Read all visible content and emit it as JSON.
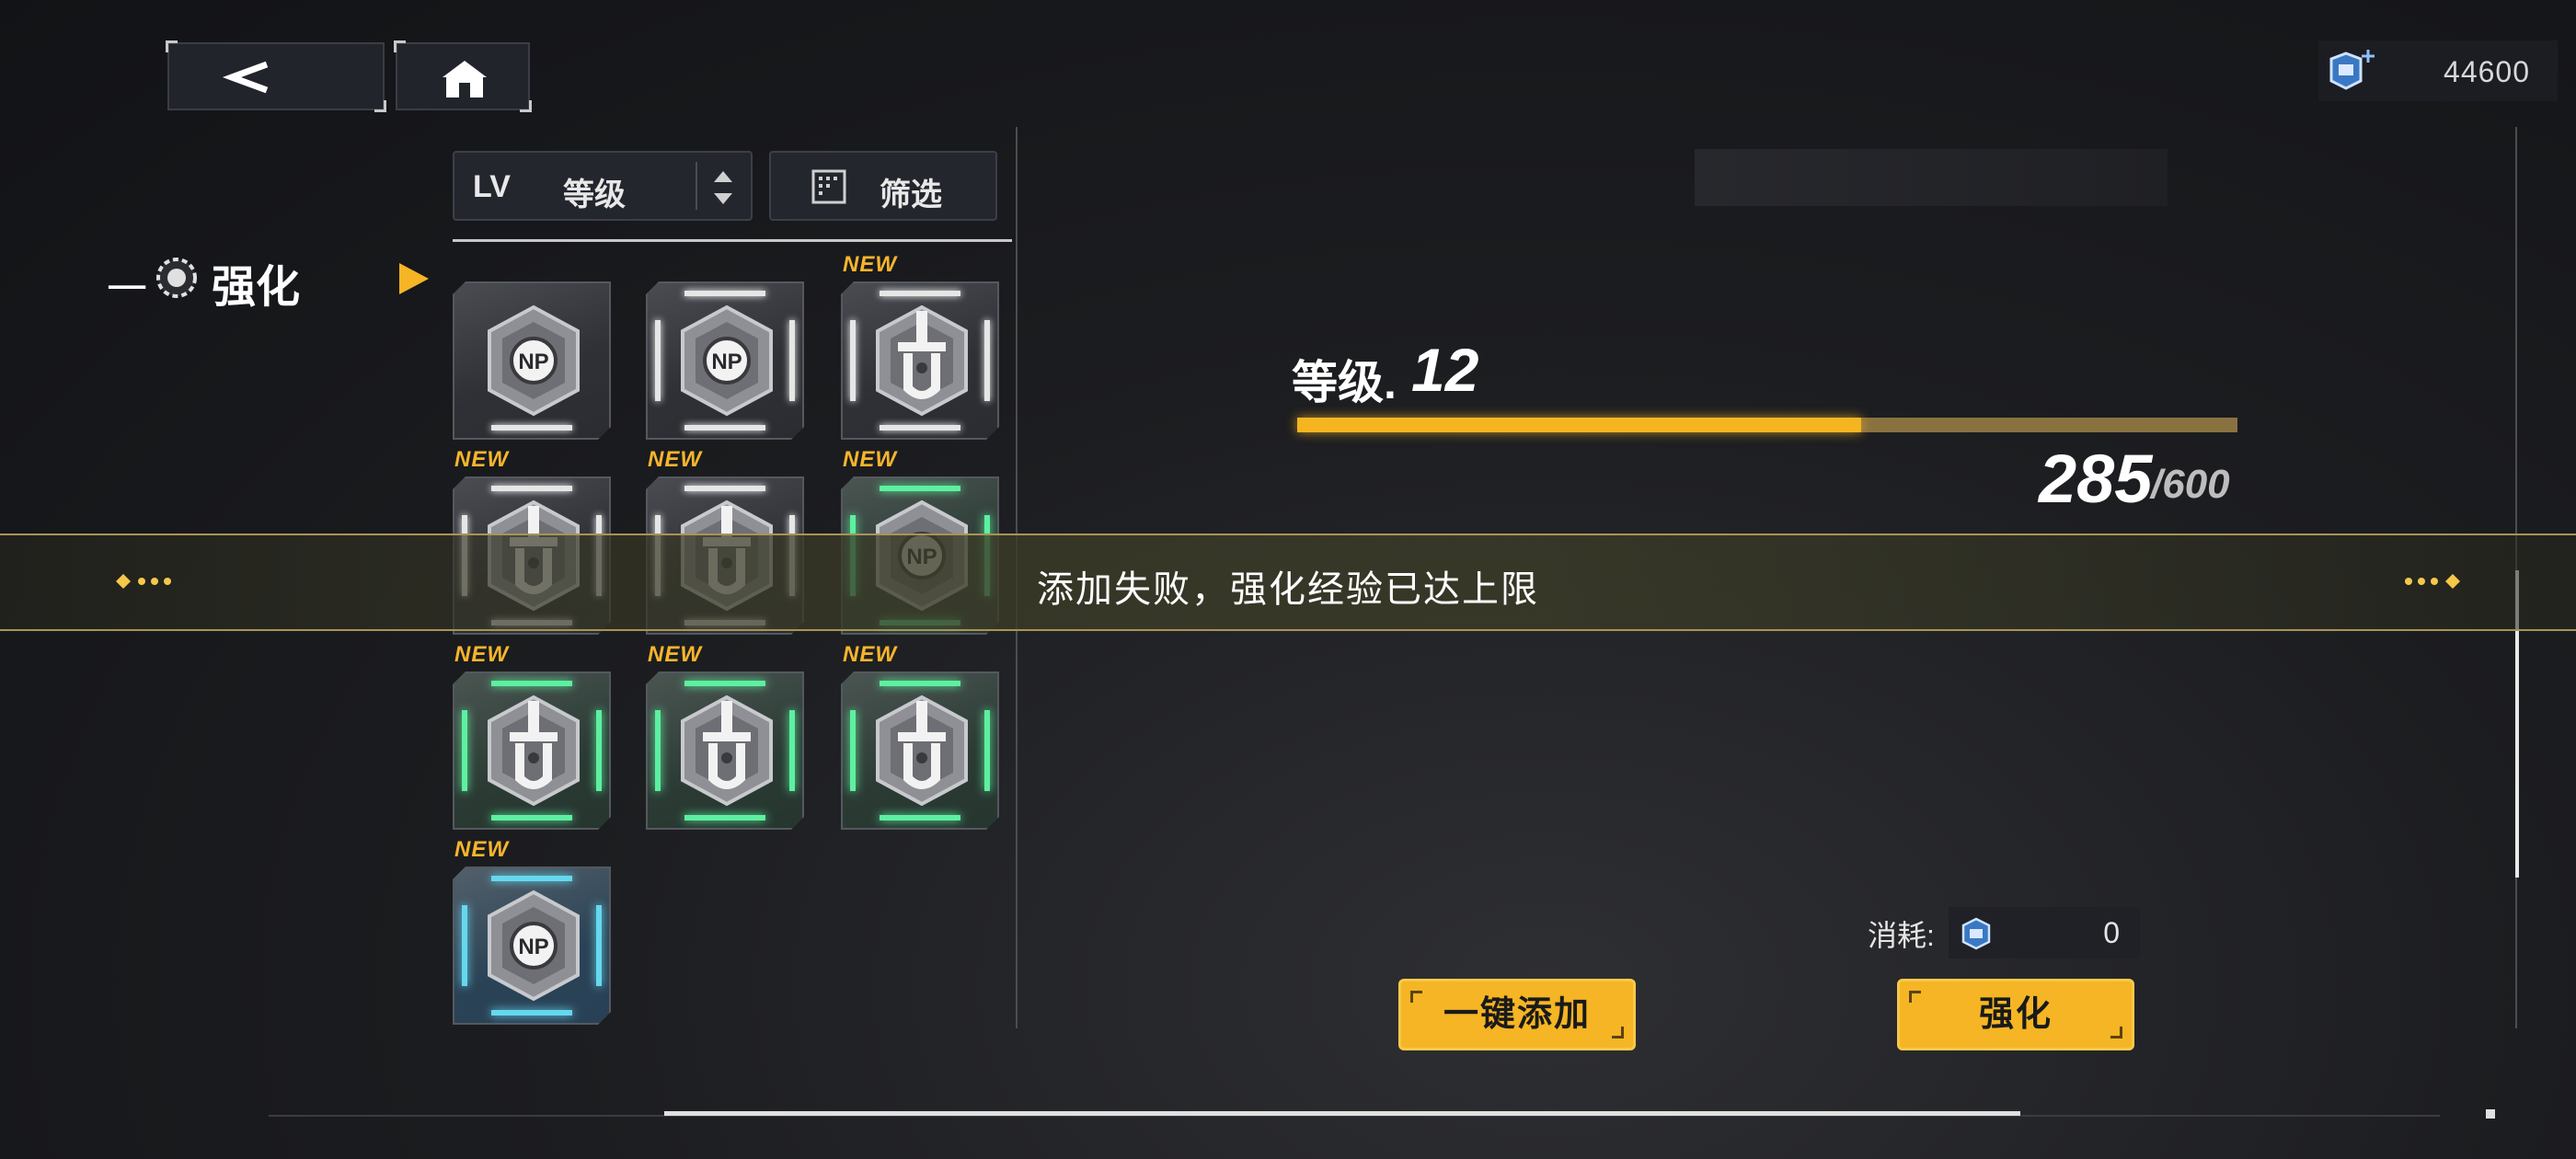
{
  "topbar": {
    "currency_value": "44600"
  },
  "controls": {
    "sort_prefix": "LV",
    "sort_label": "等级",
    "filter_label": "筛选"
  },
  "section": {
    "dash": "一",
    "title": "强化"
  },
  "items": [
    {
      "type": "np",
      "rarity": "grey",
      "new": false
    },
    {
      "type": "np",
      "rarity": "grey",
      "new": false
    },
    {
      "type": "blade",
      "rarity": "grey",
      "new": true
    },
    {
      "type": "blade",
      "rarity": "grey",
      "new": true
    },
    {
      "type": "blade",
      "rarity": "grey",
      "new": true
    },
    {
      "type": "np",
      "rarity": "green",
      "new": true
    },
    {
      "type": "blade",
      "rarity": "green",
      "new": true
    },
    {
      "type": "blade",
      "rarity": "green",
      "new": true
    },
    {
      "type": "blade",
      "rarity": "green",
      "new": true
    },
    {
      "type": "np",
      "rarity": "blue",
      "new": true
    }
  ],
  "new_tag": "NEW",
  "level": {
    "label": "等级.",
    "value": "12",
    "xp_current": "285",
    "xp_max": "/600",
    "xp_fraction": 0.6
  },
  "toast": {
    "message": "添加失败，强化经验已达上限"
  },
  "cost": {
    "label": "消耗:",
    "value": "0"
  },
  "buttons": {
    "auto_add": "一键添加",
    "enhance": "强化"
  },
  "colors": {
    "accent": "#f5b524",
    "green": "#5df0a0",
    "blue": "#65d8ee"
  }
}
